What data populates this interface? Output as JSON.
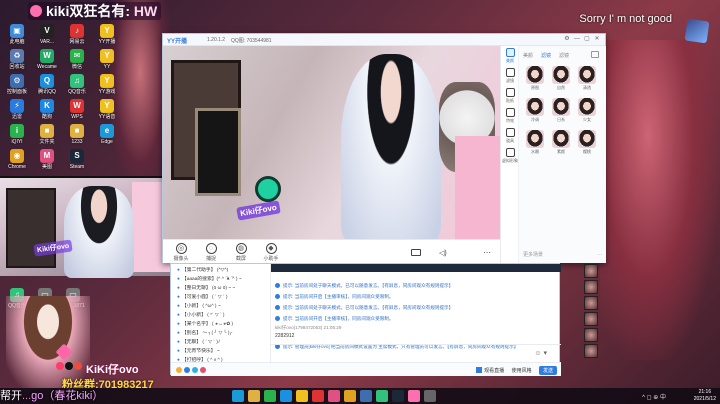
{
  "stream_overlay": {
    "title_prefix": "kiki双",
    "title_main": "狂名有: ",
    "title_brand": "HW",
    "top_right_text": "Sorry I' m not good",
    "webcam_tag": "Kiki仔ovo",
    "follower_name": "KiKi仔ovo",
    "fan_group": "粉丝群:701983217",
    "ticker_start": "帮开",
    "ticker_mid": "...",
    "ticker_end": "go（春花kiki）"
  },
  "desktop_icons": [
    {
      "label": "此电脑",
      "color": "#3d8bd9",
      "glyph": "▣"
    },
    {
      "label": "VAR...",
      "color": "#222",
      "glyph": "V"
    },
    {
      "label": "网易云",
      "color": "#d33",
      "glyph": "♪"
    },
    {
      "label": "YY开播",
      "color": "#f0c020",
      "glyph": "Y"
    },
    {
      "label": "回收站",
      "color": "#5a7ab0",
      "glyph": "♻"
    },
    {
      "label": "Wecame",
      "color": "#2a6",
      "glyph": "W"
    },
    {
      "label": "微信",
      "color": "#2bb24c",
      "glyph": "✉"
    },
    {
      "label": "YY",
      "color": "#f0c020",
      "glyph": "Y"
    },
    {
      "label": "控制面板",
      "color": "#3d6fb0",
      "glyph": "⚙"
    },
    {
      "label": "腾讯QQ",
      "color": "#1a90e0",
      "glyph": "Q"
    },
    {
      "label": "QQ音乐",
      "color": "#31c27c",
      "glyph": "♫"
    },
    {
      "label": "YY游戏",
      "color": "#f0c020",
      "glyph": "Y"
    },
    {
      "label": "迅雷",
      "color": "#2a7be0",
      "glyph": "⚡"
    },
    {
      "label": "酷狗",
      "color": "#1e88e5",
      "glyph": "K"
    },
    {
      "label": "WPS",
      "color": "#d33",
      "glyph": "W"
    },
    {
      "label": "YY语音",
      "color": "#f0c020",
      "glyph": "Y"
    },
    {
      "label": "iQIYI",
      "color": "#2ab24c",
      "glyph": "i"
    },
    {
      "label": "文件夹",
      "color": "#e0b040",
      "glyph": "■"
    },
    {
      "label": "1233",
      "color": "#e0b040",
      "glyph": "■"
    },
    {
      "label": "Edge",
      "color": "#1a9ad9",
      "glyph": "e"
    },
    {
      "label": "Chrome",
      "color": "#e0a020",
      "glyph": "◉"
    },
    {
      "label": "美图",
      "color": "#e05080",
      "glyph": "M"
    },
    {
      "label": "Steam",
      "color": "#1b2838",
      "glyph": "S"
    }
  ],
  "lower_icons": [
    {
      "label": "QQ音乐",
      "color": "#31c27c",
      "glyph": "♫"
    },
    {
      "label": "IMG_3875",
      "color": "#777",
      "glyph": "▭"
    },
    {
      "label": "IMG_3871",
      "color": "#777",
      "glyph": "▭"
    }
  ],
  "yy_window": {
    "logo": "YY开播",
    "version": "1.20.1.2",
    "qq_id": "QQ图: 703544981",
    "webcam_tag": "Kiki仔ovo",
    "toolbar": [
      {
        "label": "摄像头",
        "glyph": "◎"
      },
      {
        "label": "捕捉",
        "glyph": "◌"
      },
      {
        "label": "截屏",
        "glyph": "◍"
      },
      {
        "label": "小助手",
        "glyph": "◆"
      }
    ],
    "side_nav": [
      "美颜",
      "滤镜",
      "贴纸",
      "特效",
      "道具",
      "虚拟形象"
    ],
    "side_tabs": [
      "美颜",
      "滤镜",
      "滤镜"
    ],
    "filters": [
      "原图",
      "自然",
      "清透",
      "冷调",
      "日系",
      "少女",
      "水嫩",
      "素颜",
      "樱桃"
    ],
    "scene_label": "更多场景",
    "scene_more": "..."
  },
  "chat": {
    "left_lines": [
      "【第二代助手】 (^▽^)",
      "【aaaa的搜索】(^ ^ ͡ ᴥ ͡ ^ ) ~",
      "【整日无聊】 (ō ω ō) ~ ~",
      "【可爱小鹿】 ( ´ ▽ ` )",
      "【小新】 ( ^ω^ ) ~",
      "【小小新】 ( *´ ▽ ` )",
      "【某个名字】 ( ◕ ᴗ ◕✿ )",
      "【别名】 ～ ╮( ╯ ▽ ╰ )╭",
      "【无聊】 ( ´ ▽ ` )ﾉ",
      "【元宵节快乐】 ~",
      "【打招呼】 ( ^ v ^ )",
      "【小小】 ( ´ ∀ ` )"
    ],
    "messages": [
      {
        "type": "sys",
        "text": "提示: 当前房间处于聊天模式，已可以随意发言。【有屏息，同房间观众有规则提示】"
      },
      {
        "type": "sys",
        "text": "提示: 当前房间开启【主播审核】，同房间观众受限制。"
      },
      {
        "type": "sys",
        "text": "提示: 当前房间处于聊天模式，已可以随意发言。【有屏息，同房间观众有规则提示】"
      },
      {
        "type": "sys",
        "text": "提示: 当前房间开启【主播审核】，同房间观众受限制。"
      },
      {
        "type": "user",
        "text": "kiki仔ovo(1798472053) 21:05:29"
      },
      {
        "type": "body",
        "text": "2282912"
      },
      {
        "type": "sys",
        "text": "提示: 管理员[kiki仔ovo] 把当前房间模式设置为 主席模式，只有管理员可以发言。【有屏息，同房间观众有规则提示】"
      }
    ],
    "input_tools": "☺  ▾",
    "bottom_right": {
      "checkbox_label": "观看直播",
      "mode_label": "使用风格",
      "send_label": "发送"
    }
  },
  "taskbar": {
    "time": "21:16",
    "date": "2021/5/12",
    "tray_icons": "^ ◻ ⊕ 中"
  }
}
